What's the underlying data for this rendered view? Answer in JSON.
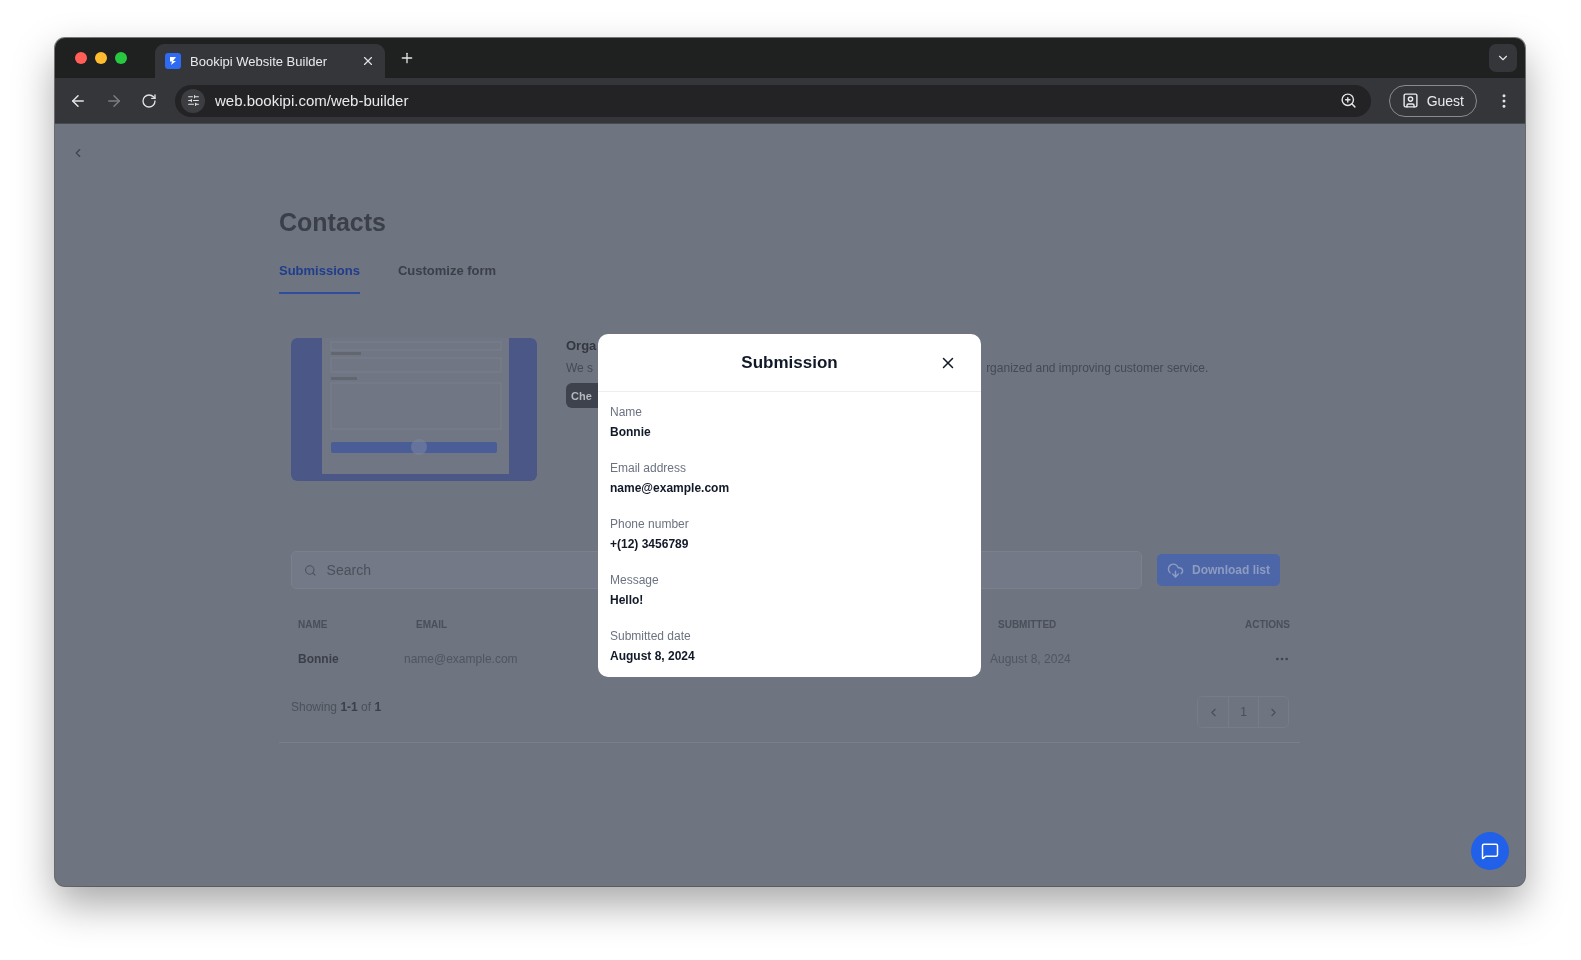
{
  "browser": {
    "tabs": [
      {
        "title": "Bookipi Website Builder",
        "selected": true
      }
    ],
    "url": "web.bookipi.com/web-builder",
    "profile_button": "Guest"
  },
  "page": {
    "title": "Contacts",
    "tabs": [
      {
        "label": "Submissions",
        "selected": true
      },
      {
        "label": "Customize form",
        "selected": false
      }
    ],
    "intro": {
      "heading": "Orga",
      "text_left": "We s",
      "text_right": "rganized and improving customer service.",
      "button": "Che"
    },
    "search": {
      "placeholder": "Search"
    },
    "download_button": "Download list",
    "table": {
      "columns": [
        "NAME",
        "EMAIL",
        "SUBMITTED",
        "ACTIONS"
      ],
      "rows": [
        {
          "name": "Bonnie",
          "email": "name@example.com",
          "submitted": "August 8, 2024"
        }
      ]
    },
    "footer": "Showing **1-1** of **1**",
    "pagination": {
      "pages": [
        "1"
      ]
    }
  },
  "modal": {
    "title": "Submission",
    "fields": [
      {
        "label": "Name",
        "value": "Bonnie"
      },
      {
        "label": "Email address",
        "value": "name@example.com"
      },
      {
        "label": "Phone number",
        "value": "+(12) 3456789"
      },
      {
        "label": "Message",
        "value": "Hello!"
      },
      {
        "label": "Submitted date",
        "value": "August 8, 2024"
      }
    ]
  }
}
